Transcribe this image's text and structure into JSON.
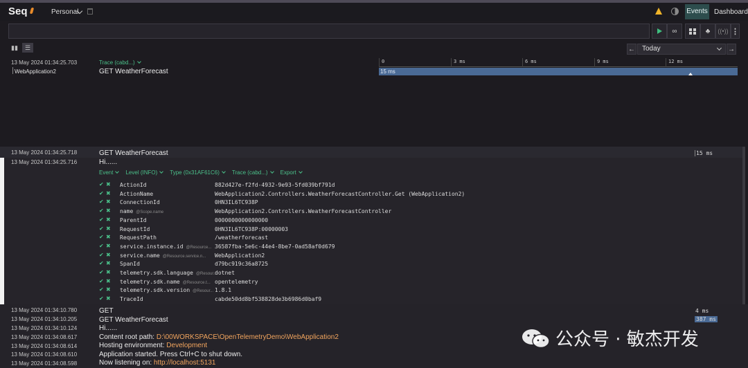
{
  "app": {
    "logo": "Seq",
    "workspace": "Personal"
  },
  "nav": {
    "events": "Events",
    "dashboards": "Dashboards"
  },
  "search": {
    "placeholder": ""
  },
  "timeline": {
    "range_label": "Today",
    "ticks": [
      "0",
      "3 ms",
      "6 ms",
      "9 ms",
      "12 ms"
    ]
  },
  "trace": {
    "timestamp": "13 May 2024  01:34:25.703",
    "link": "Trace (cabd...)",
    "service": "WebApplication2",
    "message": "GET WeatherForecast",
    "span_label": "15 ms"
  },
  "selected": {
    "timestamp": "13 May 2024  01:34:25.718",
    "message": "GET WeatherForecast",
    "duration": "15 ms"
  },
  "expanded": {
    "timestamp": "13 May 2024  01:34:25.716",
    "message": "Hi......",
    "actions": [
      "Event",
      "Level (INFO)",
      "Type (0x31AF61C6)",
      "Trace (cabd...)",
      "Export"
    ],
    "properties": [
      {
        "name": "ActionId",
        "scope": "",
        "value": "882d427e-f2fd-4932-9e93-5fd039bf791d"
      },
      {
        "name": "ActionName",
        "scope": "",
        "value": "WebApplication2.Controllers.WeatherForecastController.Get (WebApplication2)"
      },
      {
        "name": "ConnectionId",
        "scope": "",
        "value": "0HN3IL6TC938P"
      },
      {
        "name": "name",
        "scope": "@Scope.name",
        "value": "WebApplication2.Controllers.WeatherForecastController"
      },
      {
        "name": "ParentId",
        "scope": "",
        "value": "0000000000000000"
      },
      {
        "name": "RequestId",
        "scope": "",
        "value": "0HN3IL6TC938P:00000003"
      },
      {
        "name": "RequestPath",
        "scope": "",
        "value": "/weatherforecast"
      },
      {
        "name": "service.instance.id",
        "scope": "@Resource...",
        "value": "36587fba-5e6c-44e4-8be7-0ad58af0d679"
      },
      {
        "name": "service.name",
        "scope": "@Resource.service.n...",
        "value": "WebApplication2"
      },
      {
        "name": "SpanId",
        "scope": "",
        "value": "d79bc919c36a8725"
      },
      {
        "name": "telemetry.sdk.language",
        "scope": "@Resour...",
        "value": "dotnet"
      },
      {
        "name": "telemetry.sdk.name",
        "scope": "@Resource.t...",
        "value": "opentelemetry"
      },
      {
        "name": "telemetry.sdk.version",
        "scope": "@Resour...",
        "value": "1.8.1"
      },
      {
        "name": "TraceId",
        "scope": "",
        "value": "cabde50dd8bf538828de3b6986d0baf9"
      }
    ]
  },
  "events": [
    {
      "timestamp": "13 May 2024  01:34:10.780",
      "message": "GET",
      "duration": "4 ms"
    },
    {
      "timestamp": "13 May 2024  01:34:10.205",
      "message": "GET WeatherForecast",
      "duration": "387 ms"
    },
    {
      "timestamp": "13 May 2024  01:34:10.124",
      "message": "Hi......"
    },
    {
      "timestamp": "13 May 2024  01:34:08.617",
      "message": "Content root path: ",
      "highlight": "D:\\00WORKSPACE\\OpenTelemetryDemo\\WebApplication2"
    },
    {
      "timestamp": "13 May 2024  01:34:08.614",
      "message": "Hosting environment: ",
      "highlight": "Development"
    },
    {
      "timestamp": "13 May 2024  01:34:08.610",
      "message": "Application started. Press Ctrl+C to shut down."
    },
    {
      "timestamp": "13 May 2024  01:34:08.598",
      "message": "Now listening on: ",
      "highlight": "http://localhost:5131"
    }
  ],
  "watermark": {
    "text": "公众号 · 敏杰开发"
  }
}
